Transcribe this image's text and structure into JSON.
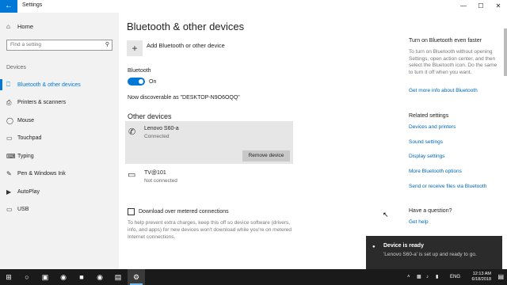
{
  "window": {
    "title": "Settings",
    "back_icon": "back-arrow-icon",
    "minimize_glyph": "—",
    "maximize_glyph": "☐",
    "close_glyph": "✕"
  },
  "sidebar": {
    "home_label": "Home",
    "search_placeholder": "Find a setting",
    "section_label": "Devices",
    "items": [
      {
        "label": "Bluetooth & other devices",
        "icon": "bluetooth-icon",
        "active": true
      },
      {
        "label": "Printers & scanners",
        "icon": "printer-icon"
      },
      {
        "label": "Mouse",
        "icon": "mouse-icon"
      },
      {
        "label": "Touchpad",
        "icon": "touchpad-icon"
      },
      {
        "label": "Typing",
        "icon": "keyboard-icon"
      },
      {
        "label": "Pen & Windows Ink",
        "icon": "pen-icon"
      },
      {
        "label": "AutoPlay",
        "icon": "autoplay-icon"
      },
      {
        "label": "USB",
        "icon": "usb-icon"
      }
    ]
  },
  "main": {
    "title": "Bluetooth & other devices",
    "add_device_label": "Add Bluetooth or other device",
    "bluetooth_label": "Bluetooth",
    "bluetooth_state": "On",
    "bluetooth_on": true,
    "discoverable_text": "Now discoverable as \"DESKTOP-N9O6OQQ\"",
    "other_devices_heading": "Other devices",
    "devices": [
      {
        "name": "Lenovo S60-a",
        "status": "Connected",
        "icon": "phone-icon",
        "remove_label": "Remove device"
      },
      {
        "name": "TV@101",
        "status": "Not connected",
        "icon": "display-icon"
      }
    ],
    "metered_label": "Download over metered connections",
    "metered_checked": false,
    "metered_help": "To help prevent extra charges, keep this off so device software (drivers, info, and apps) for new devices won't download while you're on metered Internet connections."
  },
  "right_panel": {
    "turn_on_heading": "Turn on Bluetooth even faster",
    "turn_on_text": "To turn on Bluetooth without opening Settings, open action center, and then select the Bluetooth icon. Do the same to turn it off when you want.",
    "turn_on_link": "Get more info about Bluetooth",
    "related_heading": "Related settings",
    "related_links": [
      "Devices and printers",
      "Sound settings",
      "Display settings",
      "More Bluetooth options",
      "Send or receive files via Bluetooth"
    ],
    "question_heading": "Have a question?",
    "help_link": "Get help"
  },
  "toast": {
    "title": "Device is ready",
    "message": "'Lenovo S60-a' is set up and ready to go."
  },
  "taskbar": {
    "tray_lang": "ENG",
    "time": "12:13 AM",
    "date": "6/18/2018"
  },
  "colors": {
    "accent": "#0078d7",
    "link": "#0067b8",
    "sidebar_bg": "#f2f2f2",
    "taskbar_bg": "#1a1a1a",
    "toast_bg": "#2b2b2b"
  }
}
